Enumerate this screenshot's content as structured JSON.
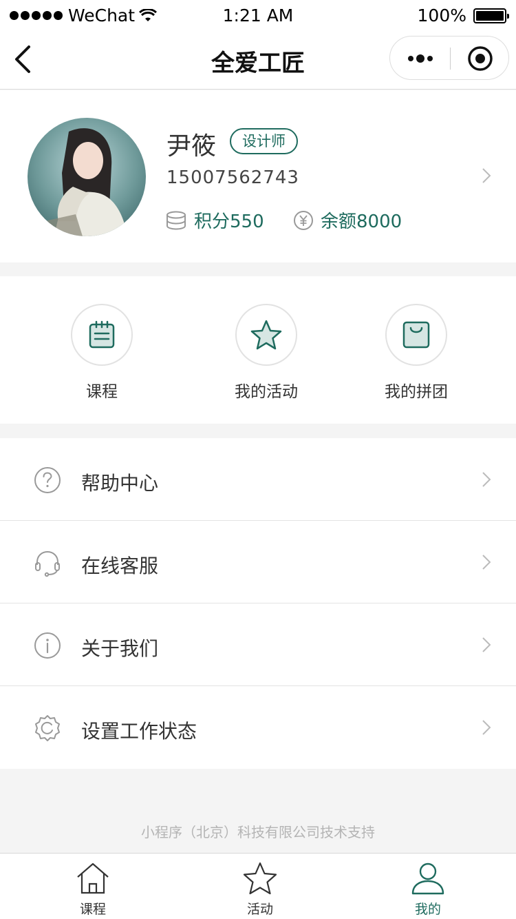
{
  "status_bar": {
    "carrier": "WeChat",
    "time": "1:21 AM",
    "battery": "100%"
  },
  "nav": {
    "title": "全爱工匠"
  },
  "profile": {
    "name": "尹筱",
    "role": "设计师",
    "phone": "15007562743",
    "points": "积分550",
    "balance": "余额8000"
  },
  "quick_actions": [
    {
      "label": "课程",
      "icon": "clipboard-icon"
    },
    {
      "label": "我的活动",
      "icon": "star-icon"
    },
    {
      "label": "我的拼团",
      "icon": "shopping-bag-icon"
    }
  ],
  "menu": [
    {
      "label": "帮助中心",
      "icon": "help-circle-icon"
    },
    {
      "label": "在线客服",
      "icon": "headset-icon"
    },
    {
      "label": "关于我们",
      "icon": "info-circle-icon"
    },
    {
      "label": "设置工作状态",
      "icon": "settings-gear-icon"
    }
  ],
  "footer": "小程序（北京）科技有限公司技术支持",
  "tabs": [
    {
      "label": "课程",
      "icon": "home-icon"
    },
    {
      "label": "活动",
      "icon": "star-outline-icon"
    },
    {
      "label": "我的",
      "icon": "user-icon",
      "active": true
    }
  ],
  "colors": {
    "accent": "#1e6b5e",
    "background": "#f4f4f4"
  }
}
